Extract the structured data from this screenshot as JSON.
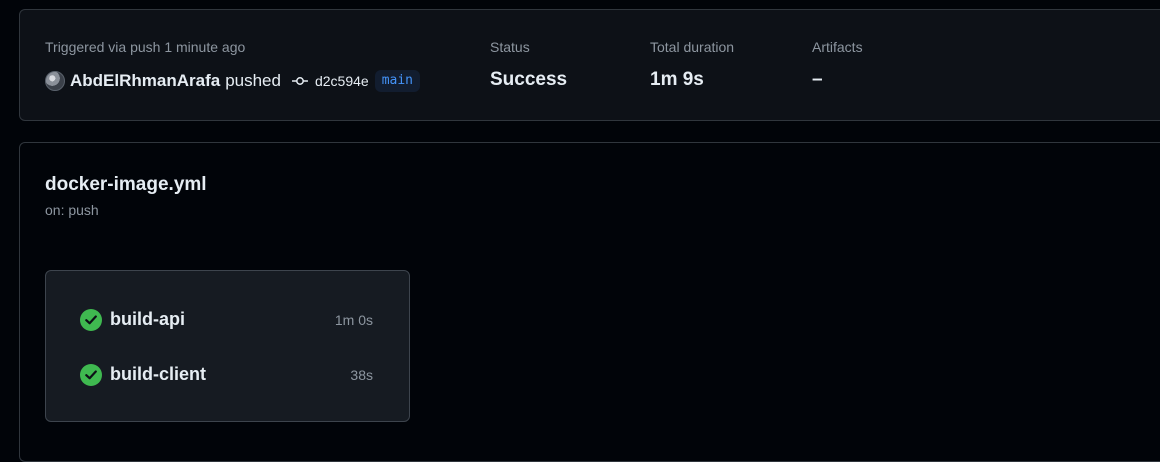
{
  "summary": {
    "trigger_text": "Triggered via push 1 minute ago",
    "actor": "AbdElRhmanArafa",
    "action": "pushed",
    "commit_sha": "d2c594e",
    "branch": "main",
    "status_label": "Status",
    "status_value": "Success",
    "duration_label": "Total duration",
    "duration_value": "1m 9s",
    "artifacts_label": "Artifacts",
    "artifacts_value": "–"
  },
  "workflow": {
    "file": "docker-image.yml",
    "trigger": "on: push",
    "jobs": [
      {
        "name": "build-api",
        "duration": "1m 0s",
        "status_icon": "success-check-icon"
      },
      {
        "name": "build-client",
        "duration": "38s",
        "status_icon": "success-check-icon"
      }
    ]
  },
  "colors": {
    "background": "#010409",
    "card": "#0d1117",
    "border": "#30363d",
    "muted_text": "#8d96a0",
    "success": "#3fb950",
    "link": "#4493f8"
  }
}
